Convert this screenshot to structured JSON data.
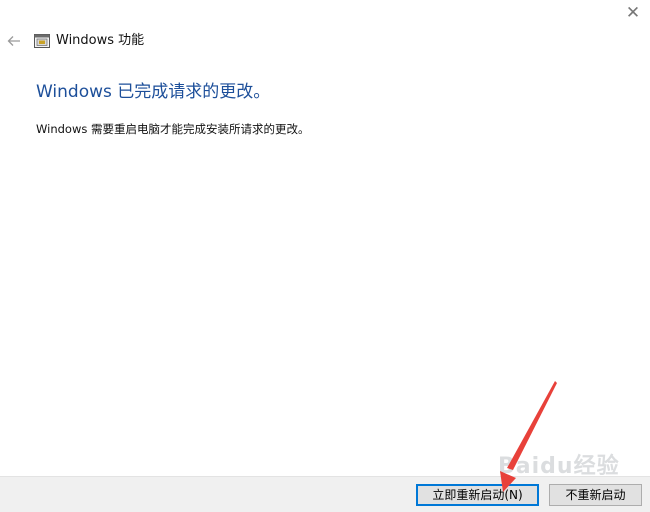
{
  "window": {
    "title": "Windows 功能",
    "close_glyph": "✕",
    "back_glyph": "←"
  },
  "content": {
    "heading": "Windows 已完成请求的更改。",
    "message": "Windows 需要重启电脑才能完成安装所请求的更改。"
  },
  "footer": {
    "restart_now_label": "立即重新启动(N)",
    "restart_later_label": "不重新启动"
  },
  "watermark": {
    "text": "Baidu经验"
  },
  "colors": {
    "heading": "#1d4f9a",
    "annotation_arrow": "#e8413a",
    "focus_border": "#0078d7"
  },
  "icons": [
    "back-arrow-icon",
    "windows-features-icon",
    "close-icon"
  ]
}
